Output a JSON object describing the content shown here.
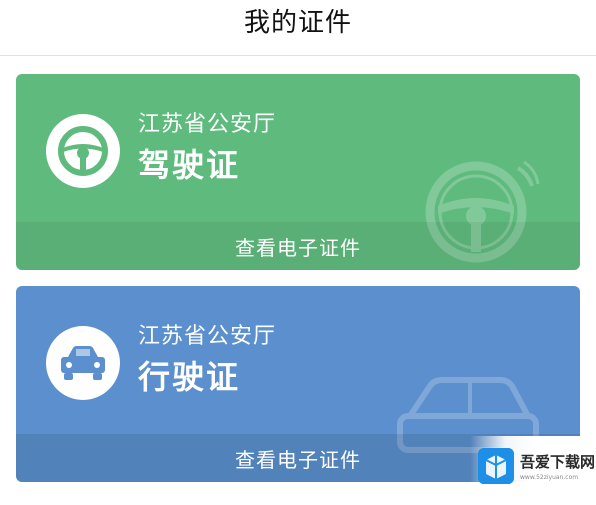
{
  "header": {
    "title": "我的证件"
  },
  "cards": [
    {
      "issuer": "江苏省公安厅",
      "name": "驾驶证",
      "action_label": "查看电子证件",
      "color": "#5fba7d",
      "icon": "steering-wheel-icon"
    },
    {
      "issuer": "江苏省公安厅",
      "name": "行驶证",
      "action_label": "查看电子证件",
      "color": "#5b8fcd",
      "icon": "car-icon"
    }
  ],
  "watermark_logo": {
    "name": "吾爱下载网",
    "url": "www.52ziyuan.com"
  }
}
